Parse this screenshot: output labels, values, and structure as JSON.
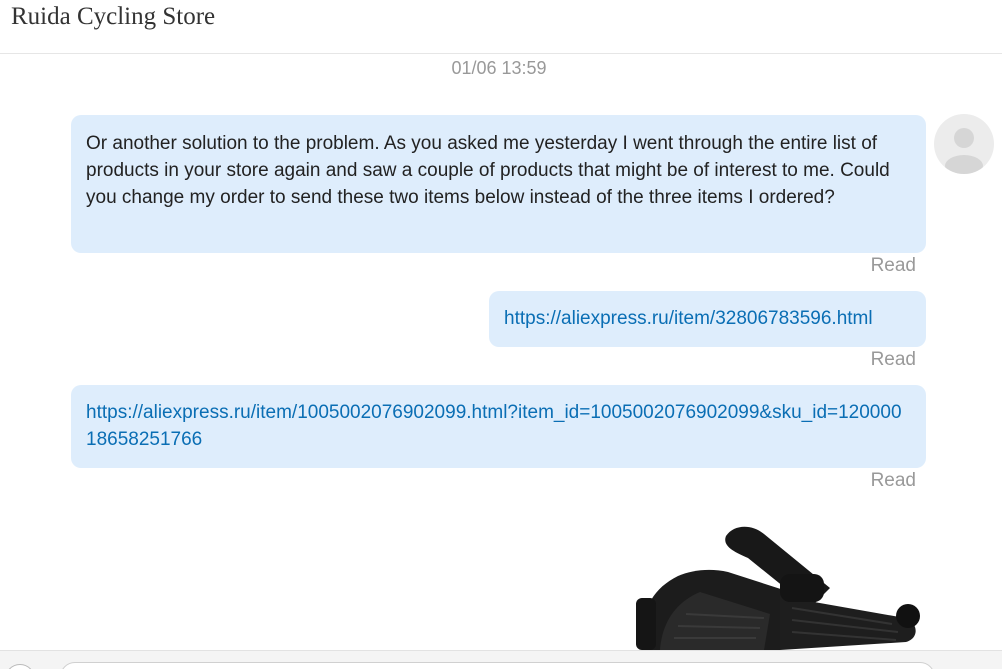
{
  "header": {
    "store_name": "Ruida Cycling Store"
  },
  "conversation": {
    "timestamp": "01/06 13:59",
    "messages": [
      {
        "text": "Or another solution to the problem. As you asked me yesterday I went through the entire list of products in your store again and saw a couple of products that might be of interest to me. Could you change my order to send these two items below instead of the three items I ordered?",
        "status": "Read"
      },
      {
        "link": "https://aliexpress.ru/item/32806783596.html",
        "status": "Read"
      },
      {
        "link": "https://aliexpress.ru/item/1005002076902099.html?item_id=1005002076902099&sku_id=12000018658251766",
        "status": "Read"
      },
      {
        "image": "bicycle-handlebar-grips-photo"
      }
    ]
  },
  "avatar": {
    "icon": "user-avatar-icon"
  },
  "colors": {
    "bubble_bg": "#deedfc",
    "link": "#0a6eb4",
    "muted_text": "#999999"
  }
}
